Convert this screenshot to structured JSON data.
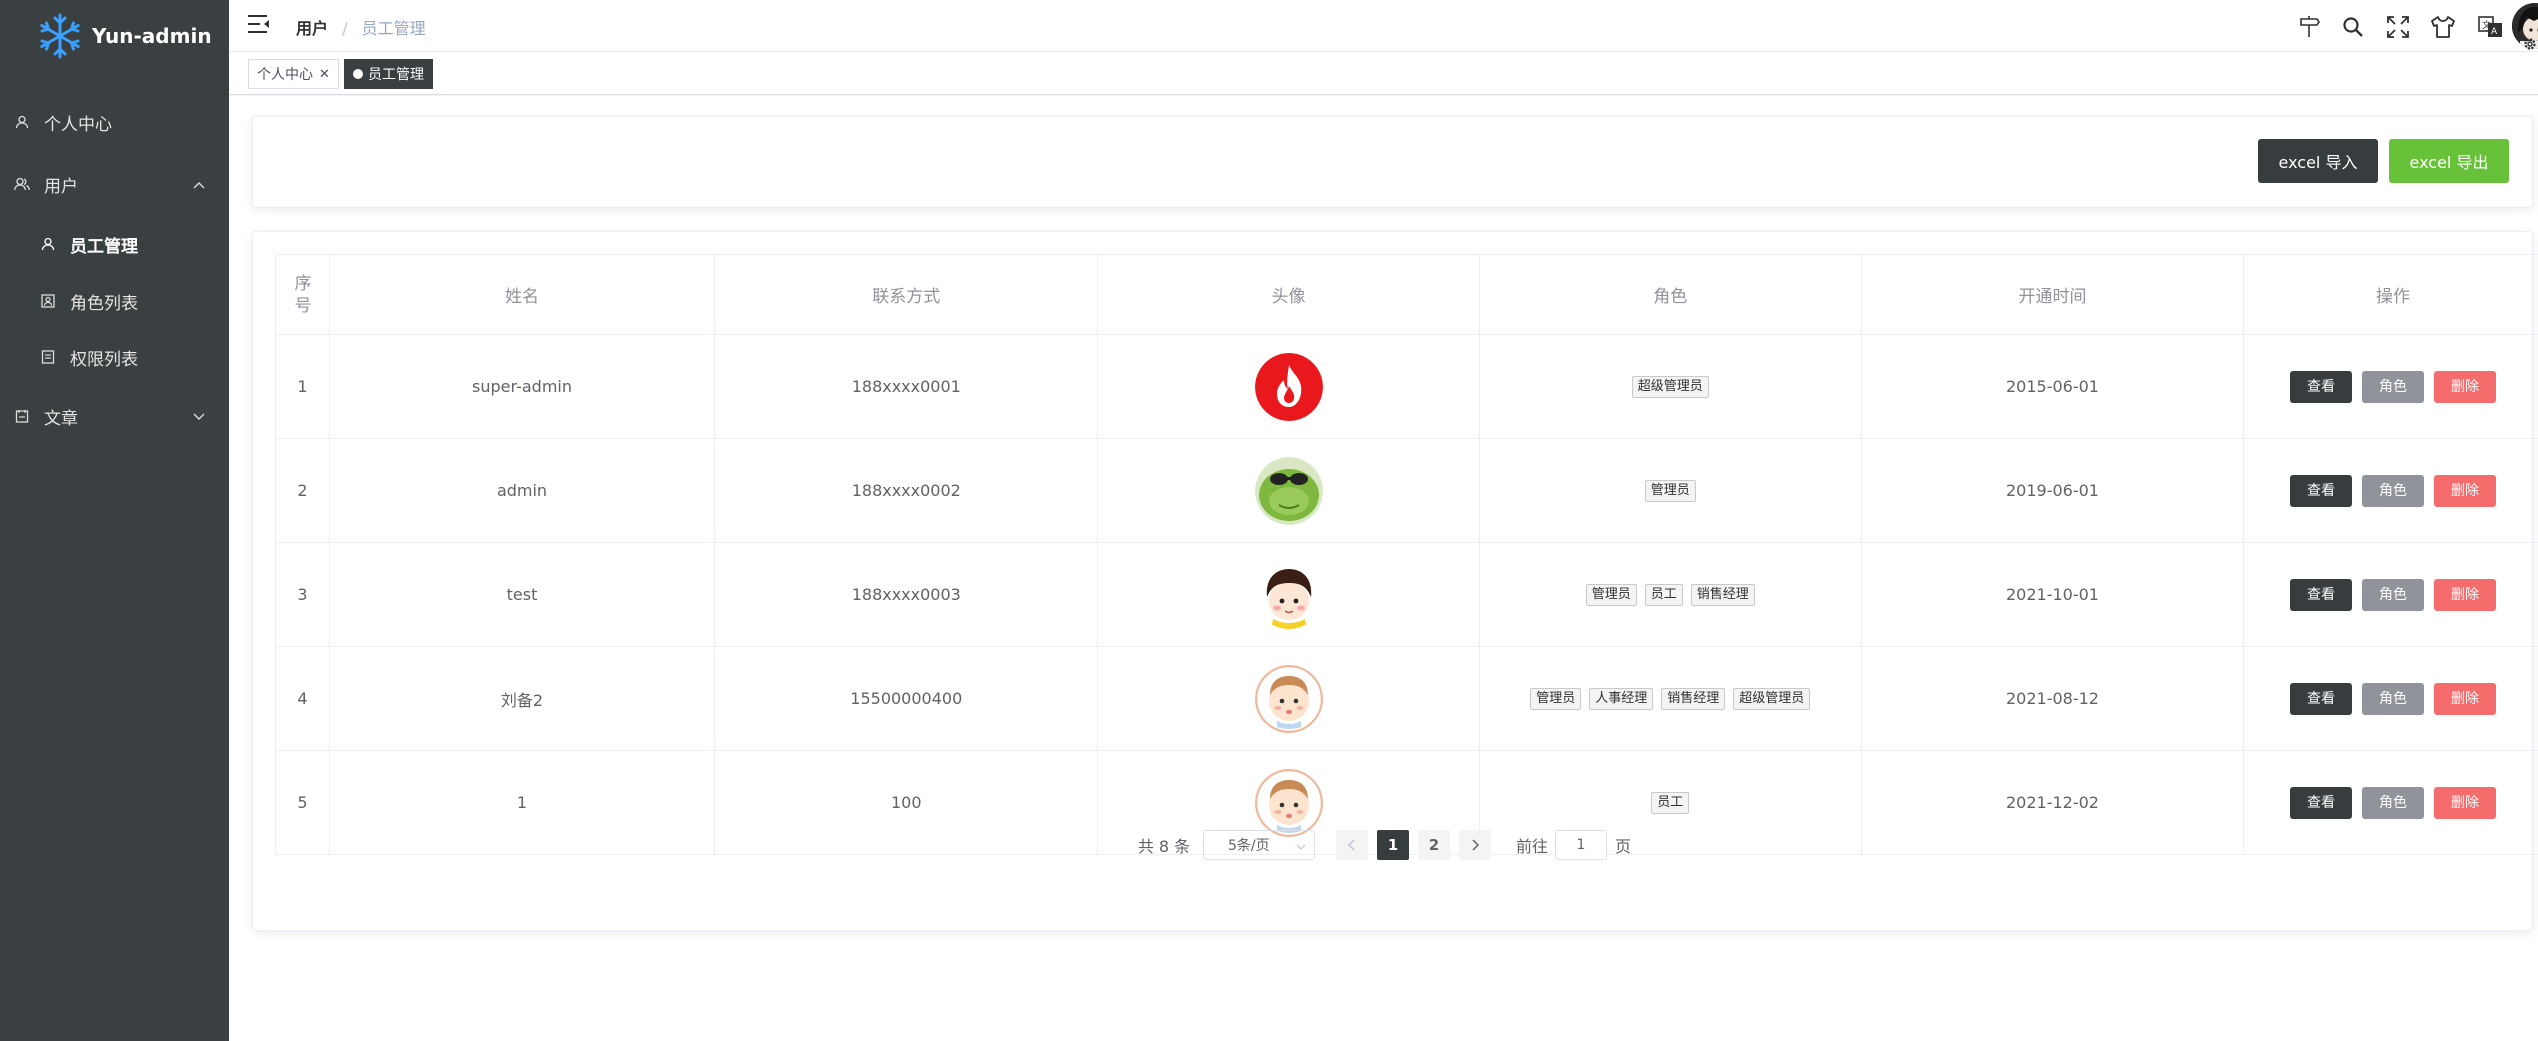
{
  "app": {
    "title": "Yun-admin"
  },
  "sidebar": {
    "items": [
      {
        "label": "个人中心",
        "icon": "user-icon"
      },
      {
        "label": "用户",
        "icon": "users-icon",
        "expanded": true
      },
      {
        "label": "员工管理",
        "icon": "user-icon",
        "active": true
      },
      {
        "label": "角色列表",
        "icon": "role-icon"
      },
      {
        "label": "权限列表",
        "icon": "lock-icon"
      },
      {
        "label": "文章",
        "icon": "doc-icon",
        "expanded": false
      }
    ]
  },
  "header": {
    "breadcrumb": [
      "用户",
      "员工管理"
    ],
    "icons": [
      "guide-icon",
      "search-icon",
      "fullscreen-icon",
      "theme-icon",
      "language-icon",
      "avatar",
      "settings-icon"
    ]
  },
  "tags": [
    {
      "label": "个人中心",
      "active": false
    },
    {
      "label": "员工管理",
      "active": true
    }
  ],
  "toolbar": {
    "import_label": "excel 导入",
    "export_label": "excel 导出"
  },
  "table": {
    "headers": [
      "序号",
      "姓名",
      "联系方式",
      "头像",
      "角色",
      "开通时间",
      "操作"
    ],
    "rows": [
      {
        "index": "1",
        "name": "super-admin",
        "mobile": "188xxxx0001",
        "avatar": "flame-avatar",
        "roles": [
          "超级管理员"
        ],
        "date": "2015-06-01"
      },
      {
        "index": "2",
        "name": "admin",
        "mobile": "188xxxx0002",
        "avatar": "frog-avatar",
        "roles": [
          "管理员"
        ],
        "date": "2019-06-01"
      },
      {
        "index": "3",
        "name": "test",
        "mobile": "188xxxx0003",
        "avatar": "boy-avatar",
        "roles": [
          "管理员",
          "员工",
          "销售经理"
        ],
        "date": "2021-10-01"
      },
      {
        "index": "4",
        "name": "刘备2",
        "mobile": "15500000400",
        "avatar": "baby-avatar",
        "roles": [
          "管理员",
          "人事经理",
          "销售经理",
          "超级管理员"
        ],
        "date": "2021-08-12"
      },
      {
        "index": "5",
        "name": "1",
        "mobile": "100",
        "avatar": "baby-avatar",
        "roles": [
          "员工"
        ],
        "date": "2021-12-02"
      }
    ],
    "actions": {
      "view": "查看",
      "role": "角色",
      "delete": "删除"
    }
  },
  "pagination": {
    "total_text": "共 8 条",
    "page_size": "5条/页",
    "pages": [
      "1",
      "2"
    ],
    "current_page": "1",
    "goto_prefix": "前往",
    "goto_value": "1",
    "goto_suffix": "页"
  },
  "colors": {
    "sidebar_bg": "#3a3f41",
    "primary_dark": "#373c3f",
    "success": "#67c23a",
    "info": "#909399",
    "danger": "#f56c6c"
  }
}
